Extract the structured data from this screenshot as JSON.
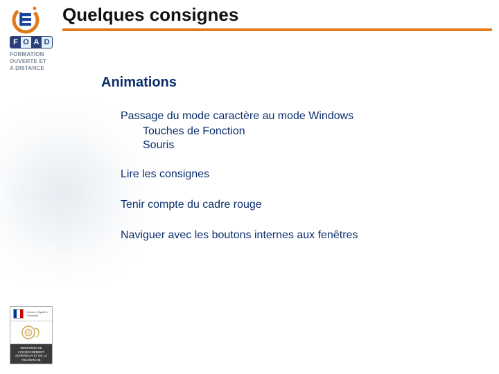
{
  "colors": {
    "accent": "#e07a1a",
    "primary_text": "#0b2e6b"
  },
  "left": {
    "foad_letters": [
      "F",
      "O",
      "A",
      "D"
    ],
    "foad_tagline_l1": "FORMATION",
    "foad_tagline_l2": "OUVERTE ET",
    "foad_tagline_l3": "A DISTANCE",
    "ministry_motto": "Liberté • Égalité • Fraternité",
    "ministry_caption": "MINISTÈRE DE L'ENSEIGNEMENT SUPÉRIEUR ET DE LA RECHERCHE"
  },
  "title": "Quelques consignes",
  "section": "Animations",
  "bullets": {
    "b1": "Passage du mode caractère au mode Windows",
    "b1a": "Touches de Fonction",
    "b1b": "Souris",
    "b2": "Lire les consignes",
    "b3": "Tenir compte du cadre rouge",
    "b4": "Naviguer avec les boutons internes aux fenêtres"
  }
}
